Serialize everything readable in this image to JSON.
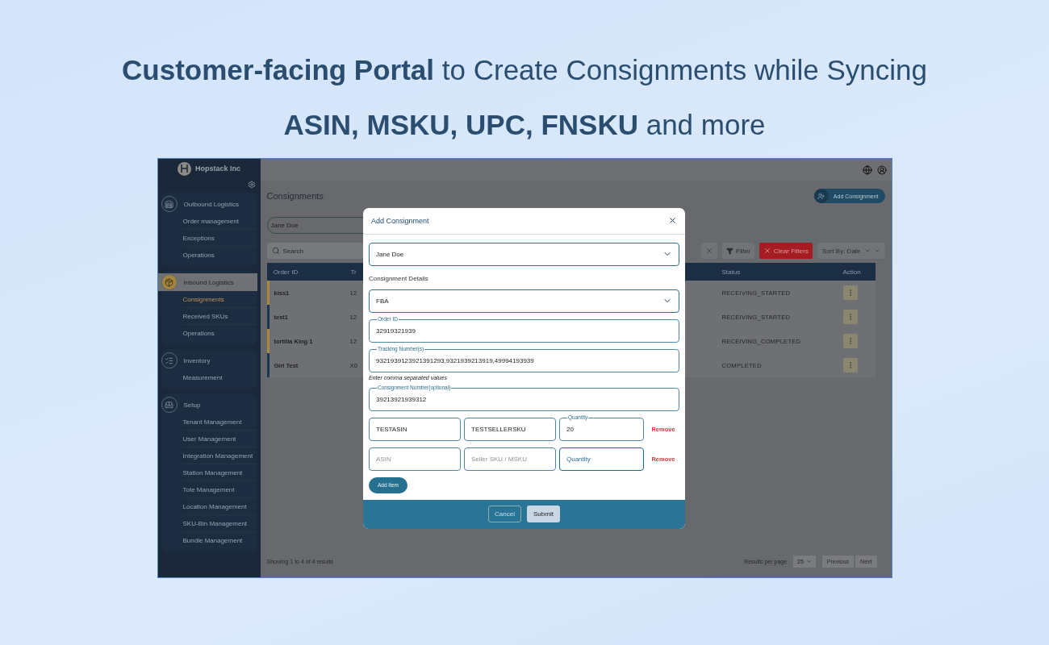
{
  "headline": {
    "line_1": "**Customer-facing Portal** to Create Consignments while Syncing",
    "line_2": "**ASIN, MSKU, UPC, FNSKU** and more"
  },
  "sidebar": {
    "brand": "Hopstack Inc",
    "sections": [
      {
        "title": "Outbound Logistics",
        "selected": false,
        "items": [
          {
            "label": "Order management",
            "selected": false
          },
          {
            "label": "Exceptions",
            "selected": false
          },
          {
            "label": "Operations",
            "selected": false
          }
        ]
      },
      {
        "title": "Inbound Logistics",
        "selected": true,
        "items": [
          {
            "label": "Consignments",
            "selected": true
          },
          {
            "label": "Received SKUs",
            "selected": false
          },
          {
            "label": "Operations",
            "selected": false
          }
        ]
      },
      {
        "title": "Inventory",
        "selected": false,
        "items": [
          {
            "label": "Measurement",
            "selected": false
          }
        ]
      },
      {
        "title": "Setup",
        "selected": false,
        "items": [
          {
            "label": "Tenant Management",
            "selected": false
          },
          {
            "label": "User Management",
            "selected": false
          },
          {
            "label": "Integration Management",
            "selected": false
          },
          {
            "label": "Station Management",
            "selected": false
          },
          {
            "label": "Tote Management",
            "selected": false
          },
          {
            "label": "Location Management",
            "selected": false
          },
          {
            "label": "SKU-Bin Management",
            "selected": false
          },
          {
            "label": "Bundle Management",
            "selected": false
          }
        ]
      }
    ]
  },
  "main": {
    "title": "Consignments",
    "add_button": "Add Consignment",
    "customer_select": "Jane Doe",
    "search": {
      "placeholder": "Search"
    },
    "filter_button": "Filter",
    "clear_filters_button": "Clear Filters",
    "sort_select": "Sort By: Date",
    "table": {
      "columns": [
        "Order ID",
        "Tr",
        "Status",
        "Action"
      ],
      "rows": [
        {
          "order_id": "kiss1",
          "column_2": "12",
          "status": "RECEIVING_STARTED",
          "color": "#a88a42"
        },
        {
          "order_id": "test1",
          "column_2": "12",
          "status": "RECEIVING_STARTED",
          "color": "#1d3552"
        },
        {
          "order_id": "tortilla King 1",
          "column_2": "12",
          "status": "RECEIVING_COMPLETED",
          "color": "#a88a42"
        },
        {
          "order_id": "Giri Test",
          "column_2": "X0",
          "status": "COMPLETED",
          "color": "#1d3552"
        }
      ]
    },
    "footer": {
      "summary": "Showing 1 to 4 of 4 results",
      "per_page_label": "Results per page",
      "per_page": "25",
      "previous": "Previous",
      "next": "Next"
    }
  },
  "modal": {
    "title": "Add Consignment",
    "fields": [
      {
        "kind": "select",
        "value": "Jane Doe"
      },
      {
        "kind": "heading",
        "text": "Consignment Details"
      },
      {
        "kind": "select",
        "value": "FBA"
      },
      {
        "kind": "outlined",
        "label": "Order ID",
        "value": "32919321939"
      },
      {
        "kind": "outlined",
        "label": "Tracking Number(s)",
        "value": "9321939123921391293,9321939213919,49994193939"
      },
      {
        "kind": "helper",
        "text": "Enter comma separated values"
      },
      {
        "kind": "outlined",
        "label": "Consignment Number(optional)",
        "value": "39213921939312"
      }
    ],
    "items": [
      {
        "cells": [
          {
            "value": "TESTASIN",
            "focused": false
          },
          {
            "value": "TESTSELLERSKU",
            "focused": false
          },
          {
            "label": "Quantity",
            "value": "20",
            "focused": false
          }
        ],
        "remove": "Remove"
      },
      {
        "cells": [
          {
            "placeholder": "ASIN",
            "focused": false
          },
          {
            "placeholder": "Seller SKU / MSKU",
            "focused": false
          },
          {
            "placeholder": "Quantity",
            "focused": true
          }
        ],
        "remove": "Remove"
      }
    ],
    "add_item_button": "Add Item",
    "cancel_button": "Cancel",
    "submit_button": "Submit"
  }
}
